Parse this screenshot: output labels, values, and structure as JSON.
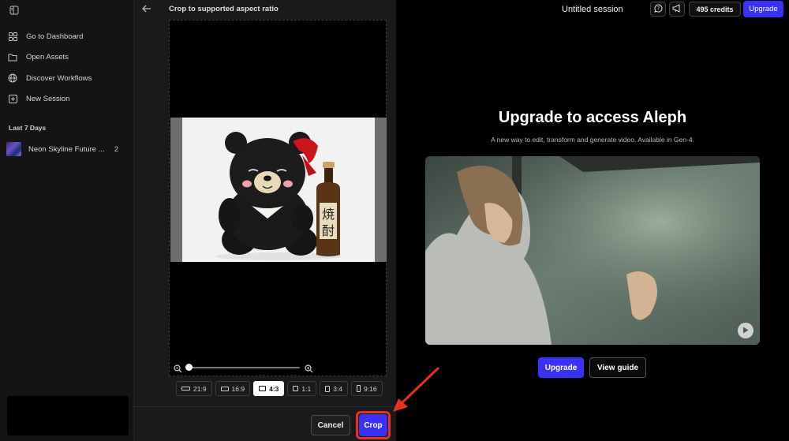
{
  "sidebar": {
    "nav": [
      {
        "label": "Go to Dashboard",
        "icon": "grid-icon"
      },
      {
        "label": "Open Assets",
        "icon": "folder-icon"
      },
      {
        "label": "Discover Workflows",
        "icon": "globe-icon"
      },
      {
        "label": "New Session",
        "icon": "plus-square-icon"
      }
    ],
    "section_label": "Last 7 Days",
    "sessions": [
      {
        "name": "Neon Skyline Future ...",
        "count": "2"
      }
    ]
  },
  "crop": {
    "title": "Crop to supported aspect ratio",
    "zoom_level": 0.0,
    "ratios": [
      {
        "label": "21:9",
        "active": false
      },
      {
        "label": "16:9",
        "active": false
      },
      {
        "label": "4:3",
        "active": true
      },
      {
        "label": "1:1",
        "active": false
      },
      {
        "label": "3:4",
        "active": false
      },
      {
        "label": "9:16",
        "active": false
      }
    ],
    "cancel_label": "Cancel",
    "crop_label": "Crop",
    "bottle_text_1": "焼",
    "bottle_text_2": "酎"
  },
  "header": {
    "session_title": "Untitled session",
    "credits": "495 credits",
    "upgrade_label": "Upgrade"
  },
  "hero": {
    "title": "Upgrade to access Aleph",
    "subtitle": "A new way to edit, transform and generate video. Available in Gen-4.",
    "upgrade_label": "Upgrade",
    "guide_label": "View guide"
  },
  "colors": {
    "accent": "#3b31f5",
    "annotation": "#e8321f"
  }
}
